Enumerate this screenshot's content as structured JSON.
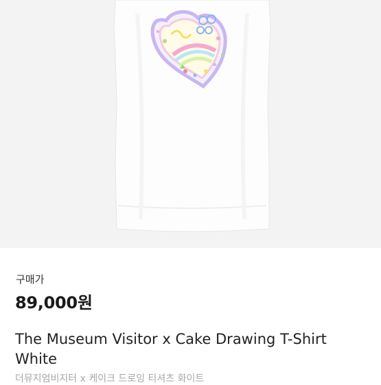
{
  "product": {
    "image_alt": "White t-shirt with pastel heart cake drawing",
    "price_label": "구매가",
    "price": "89,000원",
    "title_en": "The Museum Visitor x Cake Drawing T-Shirt White",
    "title_ko": "더뮤지엄비지터 x 케이크 드로잉 티셔츠 화이트"
  }
}
